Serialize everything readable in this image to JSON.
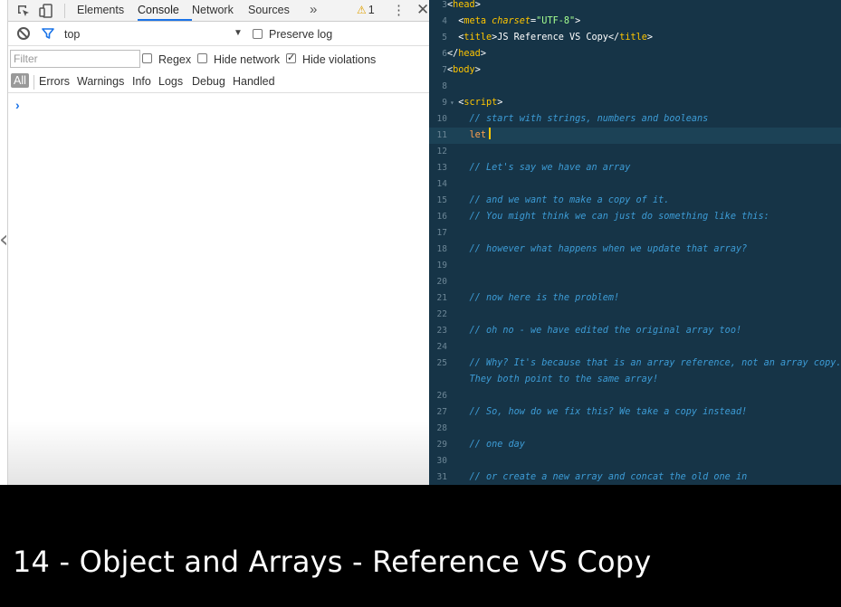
{
  "devtools": {
    "tabs": [
      "Elements",
      "Console",
      "Network",
      "Sources"
    ],
    "active_tab": "Console",
    "more_tabs_symbol": "»",
    "warning_count": "1",
    "context": "top",
    "preserve_log_label": "Preserve log",
    "preserve_log_checked": false,
    "filter_placeholder": "Filter",
    "regex_label": "Regex",
    "regex_checked": false,
    "hide_network_label": "Hide network",
    "hide_network_checked": false,
    "hide_violations_label": "Hide violations",
    "hide_violations_checked": true,
    "levels": [
      "All",
      "Errors",
      "Warnings",
      "Info",
      "Logs",
      "Debug",
      "Handled"
    ],
    "active_level": "All",
    "prompt_symbol": "›"
  },
  "editor": {
    "active_line": "11",
    "lines": [
      {
        "n": "3",
        "fold": false,
        "tokens": [
          [
            "tag",
            "<"
          ],
          [
            "name",
            "head"
          ],
          [
            "tag",
            ">"
          ]
        ]
      },
      {
        "n": "4",
        "fold": false,
        "tokens": [
          [
            "txt",
            "  "
          ],
          [
            "tag",
            "<"
          ],
          [
            "name",
            "meta "
          ],
          [
            "attr",
            "charset"
          ],
          [
            "tag",
            "="
          ],
          [
            "str",
            "\"UTF-8\""
          ],
          [
            "tag",
            ">"
          ]
        ]
      },
      {
        "n": "5",
        "fold": false,
        "tokens": [
          [
            "txt",
            "  "
          ],
          [
            "tag",
            "<"
          ],
          [
            "name",
            "title"
          ],
          [
            "tag",
            ">"
          ],
          [
            "txt",
            "JS Reference VS Copy"
          ],
          [
            "tag",
            "</"
          ],
          [
            "name",
            "title"
          ],
          [
            "tag",
            ">"
          ]
        ]
      },
      {
        "n": "6",
        "fold": false,
        "tokens": [
          [
            "tag",
            "</"
          ],
          [
            "name",
            "head"
          ],
          [
            "tag",
            ">"
          ]
        ]
      },
      {
        "n": "7",
        "fold": false,
        "tokens": [
          [
            "tag",
            "<"
          ],
          [
            "name",
            "body"
          ],
          [
            "tag",
            ">"
          ]
        ]
      },
      {
        "n": "8",
        "fold": false,
        "tokens": []
      },
      {
        "n": "9",
        "fold": true,
        "tokens": [
          [
            "txt",
            "  "
          ],
          [
            "tag",
            "<"
          ],
          [
            "name",
            "script"
          ],
          [
            "tag",
            ">"
          ]
        ]
      },
      {
        "n": "10",
        "fold": false,
        "tokens": [
          [
            "txt",
            "    "
          ],
          [
            "cm",
            "// start with strings, numbers and booleans"
          ]
        ]
      },
      {
        "n": "11",
        "fold": false,
        "cursor": true,
        "tokens": [
          [
            "txt",
            "    "
          ],
          [
            "kw",
            "let"
          ]
        ]
      },
      {
        "n": "12",
        "fold": false,
        "tokens": []
      },
      {
        "n": "13",
        "fold": false,
        "tokens": [
          [
            "txt",
            "    "
          ],
          [
            "cm",
            "// Let's say we have an array"
          ]
        ]
      },
      {
        "n": "14",
        "fold": false,
        "tokens": []
      },
      {
        "n": "15",
        "fold": false,
        "tokens": [
          [
            "txt",
            "    "
          ],
          [
            "cm",
            "// and we want to make a copy of it."
          ]
        ]
      },
      {
        "n": "16",
        "fold": false,
        "tokens": [
          [
            "txt",
            "    "
          ],
          [
            "cm",
            "// You might think we can just do something like this:"
          ]
        ]
      },
      {
        "n": "17",
        "fold": false,
        "tokens": []
      },
      {
        "n": "18",
        "fold": false,
        "tokens": [
          [
            "txt",
            "    "
          ],
          [
            "cm",
            "// however what happens when we update that array?"
          ]
        ]
      },
      {
        "n": "19",
        "fold": false,
        "tokens": []
      },
      {
        "n": "20",
        "fold": false,
        "tokens": []
      },
      {
        "n": "21",
        "fold": false,
        "tokens": [
          [
            "txt",
            "    "
          ],
          [
            "cm",
            "// now here is the problem!"
          ]
        ]
      },
      {
        "n": "22",
        "fold": false,
        "tokens": []
      },
      {
        "n": "23",
        "fold": false,
        "tokens": [
          [
            "txt",
            "    "
          ],
          [
            "cm",
            "// oh no - we have edited the original array too!"
          ]
        ]
      },
      {
        "n": "24",
        "fold": false,
        "tokens": []
      },
      {
        "n": "25",
        "fold": false,
        "tokens": [
          [
            "txt",
            "    "
          ],
          [
            "cm",
            "// Why? It's because that is an array reference, not an array copy."
          ]
        ]
      },
      {
        "n": "",
        "fold": false,
        "tokens": [
          [
            "txt",
            "    "
          ],
          [
            "cm",
            "They both point to the same array!"
          ]
        ]
      },
      {
        "n": "26",
        "fold": false,
        "tokens": []
      },
      {
        "n": "27",
        "fold": false,
        "tokens": [
          [
            "txt",
            "    "
          ],
          [
            "cm",
            "// So, how do we fix this? We take a copy instead!"
          ]
        ]
      },
      {
        "n": "28",
        "fold": false,
        "tokens": []
      },
      {
        "n": "29",
        "fold": false,
        "tokens": [
          [
            "txt",
            "    "
          ],
          [
            "cm",
            "// one day"
          ]
        ]
      },
      {
        "n": "30",
        "fold": false,
        "tokens": []
      },
      {
        "n": "31",
        "fold": false,
        "tokens": [
          [
            "txt",
            "    "
          ],
          [
            "cm",
            "// or create a new array and concat the old one in"
          ]
        ]
      }
    ]
  },
  "caption": {
    "title": "14 - Object and Arrays - Reference VS Copy"
  },
  "colors": {
    "editor_bg": "#163447",
    "active_line_bg": "#1c4256",
    "comment": "#3d9cd6",
    "tag_name": "#ffc600",
    "string": "#a5ff90",
    "keyword": "#ffa14f",
    "devtools_accent": "#1a73e8"
  },
  "icons": [
    "inspect-icon",
    "device-toolbar-icon",
    "more-tabs-icon",
    "warning-icon",
    "kebab-menu-icon",
    "close-icon",
    "clear-console-icon",
    "filter-icon",
    "dropdown-arrow-icon",
    "collapse-arrow-icon",
    "console-prompt-icon"
  ]
}
